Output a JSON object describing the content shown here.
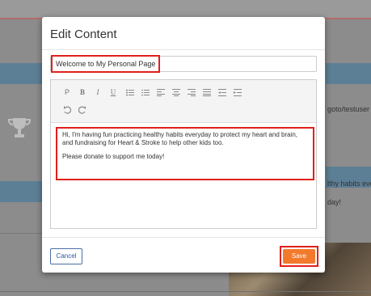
{
  "background": {
    "profile_link": "goto/testuser",
    "side_text_1": "lthy habits ever",
    "side_text_2": "day!"
  },
  "modal": {
    "title": "Edit Content",
    "title_field_value": "Welcome to My Personal Page",
    "toolbar": {
      "paragraph": "P",
      "bold": "B",
      "italic": "I",
      "underline": "U"
    },
    "content": {
      "paragraph_1": "Hi, I'm having fun practicing healthy habits everyday to protect my heart and brain, and fundraising for Heart & Stroke to help other kids too.",
      "paragraph_2": "Please donate to support me today!"
    },
    "cancel_label": "Cancel",
    "save_label": "Save"
  },
  "colors": {
    "highlight": "#e0201b",
    "save_button": "#f37a2c",
    "cancel_text": "#2a5796"
  }
}
